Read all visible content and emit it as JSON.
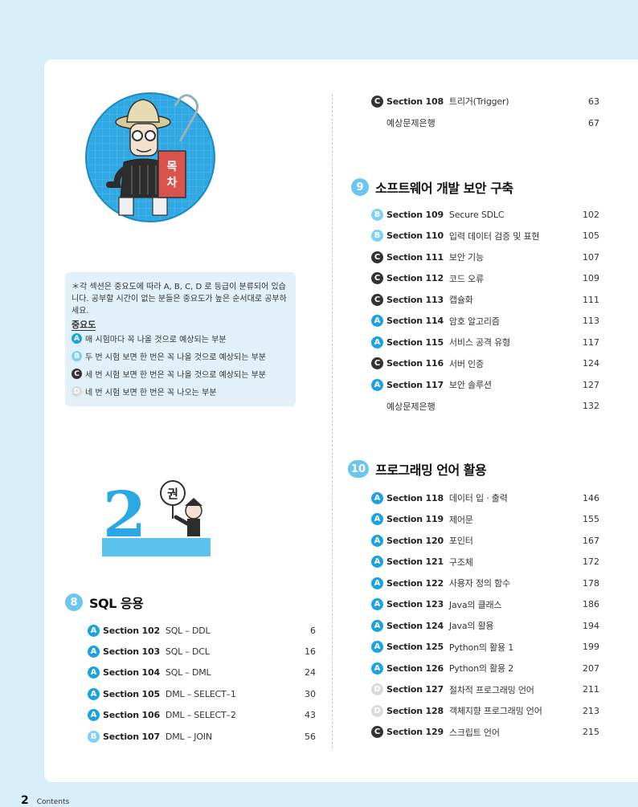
{
  "legend": {
    "note": "＊각 섹션은 중요도에 따라 A, B, C, D 로 등급이 분류되어 있습니다. 공부할 시간이 없는 분들은 중요도가 높은 순서대로 공부하세요.",
    "heading": "중요도",
    "grades": [
      {
        "grade": "A",
        "text": "매 시험마다 꼭 나올 것으로 예상되는 부분"
      },
      {
        "grade": "B",
        "text": "두 번 시험 보면 한 번은 꼭 나올 것으로 예상되는 부분"
      },
      {
        "grade": "C",
        "text": "세 번 시험 보면 한 번은 꼭 나올 것으로 예상되는 부분"
      },
      {
        "grade": "D",
        "text": "네 번 시험 보면 한 번은 꼭 나오는 부분"
      }
    ]
  },
  "mascot": {
    "book_text": "목차"
  },
  "part": {
    "number": "2",
    "label": "권"
  },
  "chapter8": {
    "number": "8",
    "title": "SQL 응용",
    "items": [
      {
        "grade": "A",
        "section": "Section 102",
        "name": "SQL – DDL",
        "page": "6"
      },
      {
        "grade": "A",
        "section": "Section 103",
        "name": "SQL – DCL",
        "page": "16"
      },
      {
        "grade": "A",
        "section": "Section 104",
        "name": "SQL – DML",
        "page": "24"
      },
      {
        "grade": "A",
        "section": "Section 105",
        "name": "DML – SELECT–1",
        "page": "30"
      },
      {
        "grade": "A",
        "section": "Section 106",
        "name": "DML – SELECT–2",
        "page": "43"
      },
      {
        "grade": "B",
        "section": "Section 107",
        "name": "DML – JOIN",
        "page": "56"
      }
    ]
  },
  "chapter8_cont": {
    "items": [
      {
        "grade": "C",
        "section": "Section 108",
        "name": "트리거(Trigger)",
        "page": "63"
      },
      {
        "grade": "",
        "section": "",
        "name": "예상문제은행",
        "page": "67"
      }
    ]
  },
  "chapter9": {
    "number": "9",
    "title": "소프트웨어 개발 보안 구축",
    "items": [
      {
        "grade": "B",
        "section": "Section 109",
        "name": "Secure SDLC",
        "page": "102"
      },
      {
        "grade": "B",
        "section": "Section 110",
        "name": "입력 데이터 검증 및 표현",
        "page": "105"
      },
      {
        "grade": "C",
        "section": "Section 111",
        "name": "보안 기능",
        "page": "107"
      },
      {
        "grade": "C",
        "section": "Section 112",
        "name": "코드 오류",
        "page": "109"
      },
      {
        "grade": "C",
        "section": "Section 113",
        "name": "캡슐화",
        "page": "111"
      },
      {
        "grade": "A",
        "section": "Section 114",
        "name": "암호 알고리즘",
        "page": "113"
      },
      {
        "grade": "A",
        "section": "Section 115",
        "name": "서비스 공격 유형",
        "page": "117"
      },
      {
        "grade": "C",
        "section": "Section 116",
        "name": "서버 인증",
        "page": "124"
      },
      {
        "grade": "A",
        "section": "Section 117",
        "name": "보안 솔루션",
        "page": "127"
      },
      {
        "grade": "",
        "section": "",
        "name": "예상문제은행",
        "page": "132"
      }
    ]
  },
  "chapter10": {
    "number": "10",
    "title": "프로그래밍 언어 활용",
    "items": [
      {
        "grade": "A",
        "section": "Section 118",
        "name": "데이터 입 · 출력",
        "page": "146"
      },
      {
        "grade": "A",
        "section": "Section 119",
        "name": "제어문",
        "page": "155"
      },
      {
        "grade": "A",
        "section": "Section 120",
        "name": "포인터",
        "page": "167"
      },
      {
        "grade": "A",
        "section": "Section 121",
        "name": "구조체",
        "page": "172"
      },
      {
        "grade": "A",
        "section": "Section 122",
        "name": "사용자 정의 함수",
        "page": "178"
      },
      {
        "grade": "A",
        "section": "Section 123",
        "name": "Java의 클래스",
        "page": "186"
      },
      {
        "grade": "A",
        "section": "Section 124",
        "name": "Java의 활용",
        "page": "194"
      },
      {
        "grade": "A",
        "section": "Section 125",
        "name": "Python의 활용 1",
        "page": "199"
      },
      {
        "grade": "A",
        "section": "Section 126",
        "name": "Python의 활용 2",
        "page": "207"
      },
      {
        "grade": "D",
        "section": "Section 127",
        "name": "절차적 프로그래밍 언어",
        "page": "211"
      },
      {
        "grade": "D",
        "section": "Section 128",
        "name": "객체지향 프로그래밍 언어",
        "page": "213"
      },
      {
        "grade": "C",
        "section": "Section 129",
        "name": "스크립트 언어",
        "page": "215"
      }
    ]
  },
  "footer": {
    "page_number": "2",
    "label": "Contents"
  },
  "colors": {
    "background": "#d8eef8",
    "accent": "#1aa3e0",
    "gradeB": "#7fd0f3",
    "gradeC": "#333333",
    "gradeD": "#dadada",
    "chapterBadge": "#6cc7ee"
  }
}
